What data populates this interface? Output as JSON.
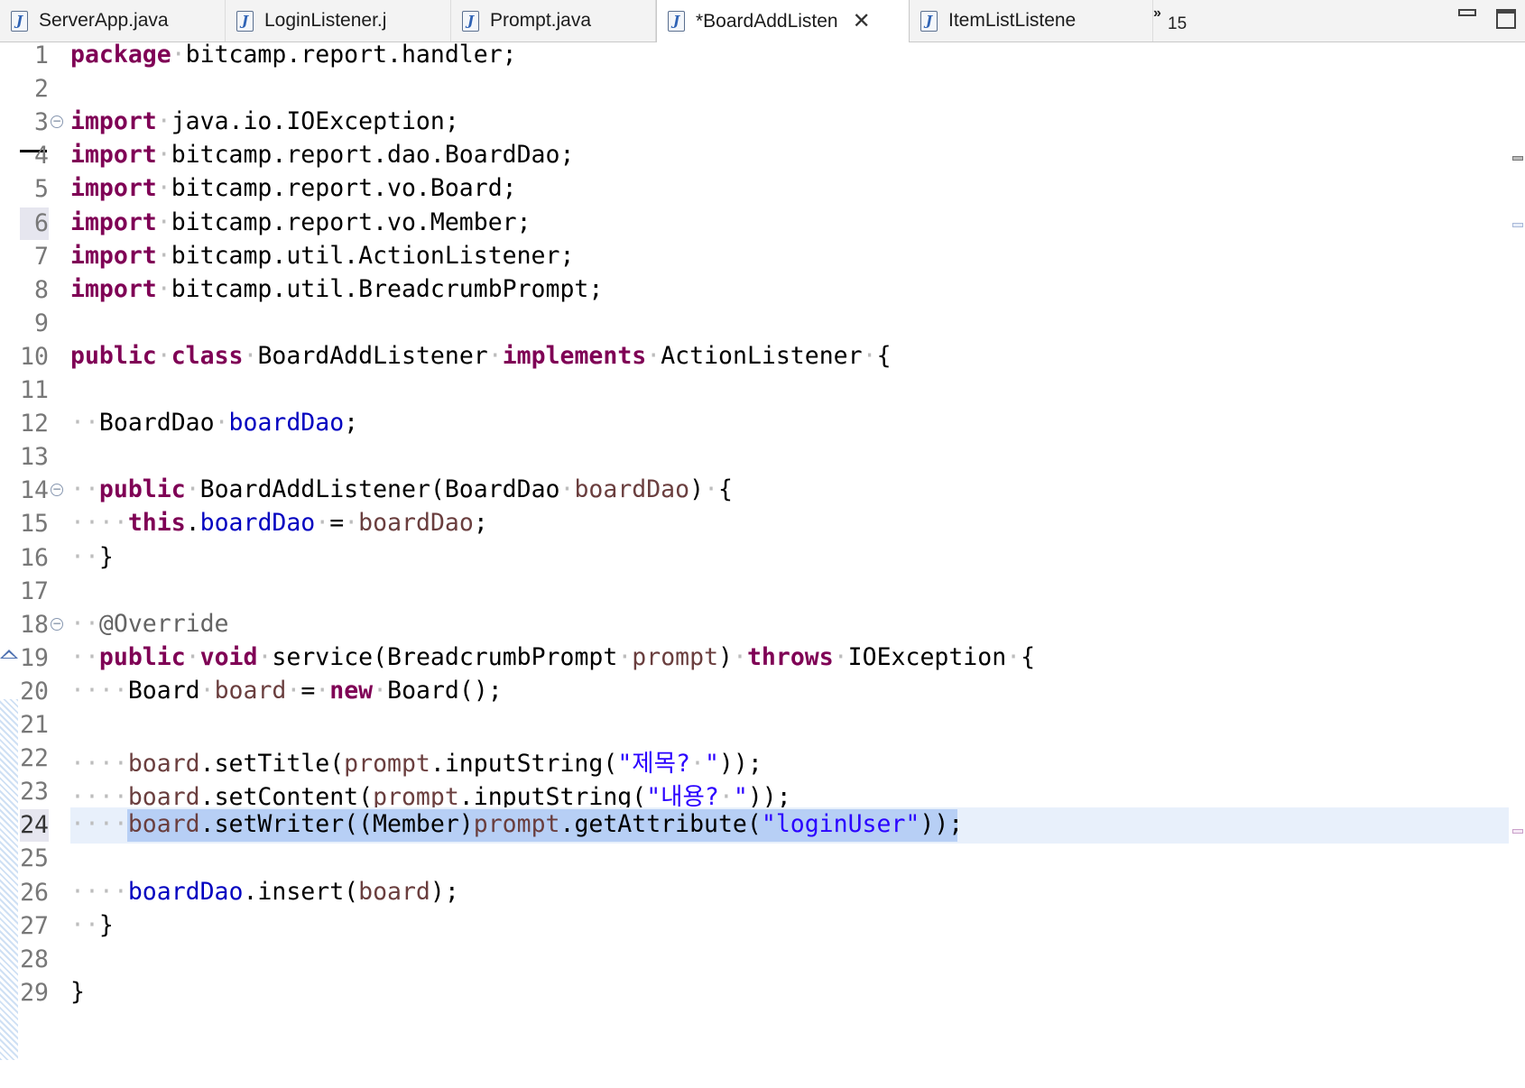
{
  "tabs": [
    {
      "label": "ServerApp.java",
      "active": false
    },
    {
      "label": "LoginListener.j",
      "active": false
    },
    {
      "label": "Prompt.java",
      "active": false
    },
    {
      "label": "*BoardAddListen",
      "active": true
    },
    {
      "label": "ItemListListene",
      "active": false
    }
  ],
  "tab_icon_glyph": "J",
  "overflow": {
    "chevron": "»",
    "count": "15"
  },
  "close_glyph": "✕",
  "editor": {
    "current_line": "24",
    "lines": [
      {
        "num": "1",
        "tokens": [
          [
            "kw",
            "package"
          ],
          [
            "ws",
            "·"
          ],
          [
            "t",
            "bitcamp.report.handler;"
          ]
        ]
      },
      {
        "num": "2",
        "tokens": []
      },
      {
        "num": "3",
        "fold": true,
        "tokens": [
          [
            "kw",
            "import"
          ],
          [
            "ws",
            "·"
          ],
          [
            "t",
            "java.io.IOException;"
          ]
        ]
      },
      {
        "num": "4",
        "tokens": [
          [
            "kw",
            "import"
          ],
          [
            "ws",
            "·"
          ],
          [
            "t",
            "bitcamp.report.dao.BoardDao;"
          ]
        ]
      },
      {
        "num": "5",
        "tokens": [
          [
            "kw",
            "import"
          ],
          [
            "ws",
            "·"
          ],
          [
            "t",
            "bitcamp.report.vo.Board;"
          ]
        ]
      },
      {
        "num": "6",
        "tokens": [
          [
            "kw",
            "import"
          ],
          [
            "ws",
            "·"
          ],
          [
            "t",
            "bitcamp.report.vo.Member;"
          ]
        ]
      },
      {
        "num": "7",
        "tokens": [
          [
            "kw",
            "import"
          ],
          [
            "ws",
            "·"
          ],
          [
            "t",
            "bitcamp.util.ActionListener;"
          ]
        ]
      },
      {
        "num": "8",
        "tokens": [
          [
            "kw",
            "import"
          ],
          [
            "ws",
            "·"
          ],
          [
            "t",
            "bitcamp.util.BreadcrumbPrompt;"
          ]
        ]
      },
      {
        "num": "9",
        "tokens": []
      },
      {
        "num": "10",
        "tokens": [
          [
            "kw",
            "public"
          ],
          [
            "ws",
            "·"
          ],
          [
            "kw",
            "class"
          ],
          [
            "ws",
            "·"
          ],
          [
            "t",
            "BoardAddListener"
          ],
          [
            "ws",
            "·"
          ],
          [
            "kw",
            "implements"
          ],
          [
            "ws",
            "·"
          ],
          [
            "t",
            "ActionListener"
          ],
          [
            "ws",
            "·"
          ],
          [
            "t",
            "{"
          ]
        ]
      },
      {
        "num": "11",
        "tokens": []
      },
      {
        "num": "12",
        "tokens": [
          [
            "ws",
            "··"
          ],
          [
            "t",
            "BoardDao"
          ],
          [
            "ws",
            "·"
          ],
          [
            "fld",
            "boardDao"
          ],
          [
            "t",
            ";"
          ]
        ]
      },
      {
        "num": "13",
        "tokens": []
      },
      {
        "num": "14",
        "fold": true,
        "tokens": [
          [
            "ws",
            "··"
          ],
          [
            "kw",
            "public"
          ],
          [
            "ws",
            "·"
          ],
          [
            "t",
            "BoardAddListener(BoardDao"
          ],
          [
            "ws",
            "·"
          ],
          [
            "prm",
            "boardDao"
          ],
          [
            "t",
            ")"
          ],
          [
            "ws",
            "·"
          ],
          [
            "t",
            "{"
          ]
        ]
      },
      {
        "num": "15",
        "tokens": [
          [
            "ws",
            "····"
          ],
          [
            "kw",
            "this"
          ],
          [
            "t",
            "."
          ],
          [
            "fld",
            "boardDao"
          ],
          [
            "ws",
            "·"
          ],
          [
            "t",
            "="
          ],
          [
            "ws",
            "·"
          ],
          [
            "prm",
            "boardDao"
          ],
          [
            "t",
            ";"
          ]
        ]
      },
      {
        "num": "16",
        "tokens": [
          [
            "ws",
            "··"
          ],
          [
            "t",
            "}"
          ]
        ]
      },
      {
        "num": "17",
        "tokens": []
      },
      {
        "num": "18",
        "fold": true,
        "tokens": [
          [
            "ws",
            "··"
          ],
          [
            "ann",
            "@Override"
          ]
        ]
      },
      {
        "num": "19",
        "override": true,
        "tokens": [
          [
            "ws",
            "··"
          ],
          [
            "kw",
            "public"
          ],
          [
            "ws",
            "·"
          ],
          [
            "kw",
            "void"
          ],
          [
            "ws",
            "·"
          ],
          [
            "t",
            "service(BreadcrumbPrompt"
          ],
          [
            "ws",
            "·"
          ],
          [
            "prm",
            "prompt"
          ],
          [
            "t",
            ")"
          ],
          [
            "ws",
            "·"
          ],
          [
            "kw",
            "throws"
          ],
          [
            "ws",
            "·"
          ],
          [
            "t",
            "IOException"
          ],
          [
            "ws",
            "·"
          ],
          [
            "t",
            "{"
          ]
        ]
      },
      {
        "num": "20",
        "tokens": [
          [
            "ws",
            "····"
          ],
          [
            "t",
            "Board"
          ],
          [
            "ws",
            "·"
          ],
          [
            "prm",
            "board"
          ],
          [
            "ws",
            "·"
          ],
          [
            "t",
            "="
          ],
          [
            "ws",
            "·"
          ],
          [
            "kw",
            "new"
          ],
          [
            "ws",
            "·"
          ],
          [
            "t",
            "Board();"
          ]
        ]
      },
      {
        "num": "21",
        "tokens": []
      },
      {
        "num": "22",
        "tokens": [
          [
            "ws",
            "····"
          ],
          [
            "prm",
            "board"
          ],
          [
            "t",
            ".setTitle("
          ],
          [
            "prm",
            "prompt"
          ],
          [
            "t",
            ".inputString("
          ],
          [
            "str",
            "\"제목?"
          ],
          [
            "ws",
            "·"
          ],
          [
            "str",
            "\""
          ],
          [
            "t",
            "));"
          ]
        ]
      },
      {
        "num": "23",
        "tokens": [
          [
            "ws",
            "····"
          ],
          [
            "prm",
            "board"
          ],
          [
            "t",
            ".setContent("
          ],
          [
            "prm",
            "prompt"
          ],
          [
            "t",
            ".inputString("
          ],
          [
            "str",
            "\"내용?"
          ],
          [
            "ws",
            "·"
          ],
          [
            "str",
            "\""
          ],
          [
            "t",
            "));"
          ]
        ]
      },
      {
        "num": "24",
        "selected": true,
        "tokens": [
          [
            "ws",
            "····"
          ],
          [
            "prm",
            "board"
          ],
          [
            "t",
            ".setWriter((Member)"
          ],
          [
            "prm",
            "prompt"
          ],
          [
            "t",
            ".getAttribute("
          ],
          [
            "str",
            "\"loginUser\""
          ],
          [
            "t",
            "));"
          ]
        ]
      },
      {
        "num": "25",
        "tokens": []
      },
      {
        "num": "26",
        "tokens": [
          [
            "ws",
            "····"
          ],
          [
            "fld",
            "boardDao"
          ],
          [
            "t",
            ".insert("
          ],
          [
            "prm",
            "board"
          ],
          [
            "t",
            ");"
          ]
        ]
      },
      {
        "num": "27",
        "tokens": [
          [
            "ws",
            "··"
          ],
          [
            "t",
            "}"
          ]
        ]
      },
      {
        "num": "28",
        "tokens": []
      },
      {
        "num": "29",
        "tokens": [
          [
            "t",
            "}"
          ]
        ]
      }
    ]
  }
}
